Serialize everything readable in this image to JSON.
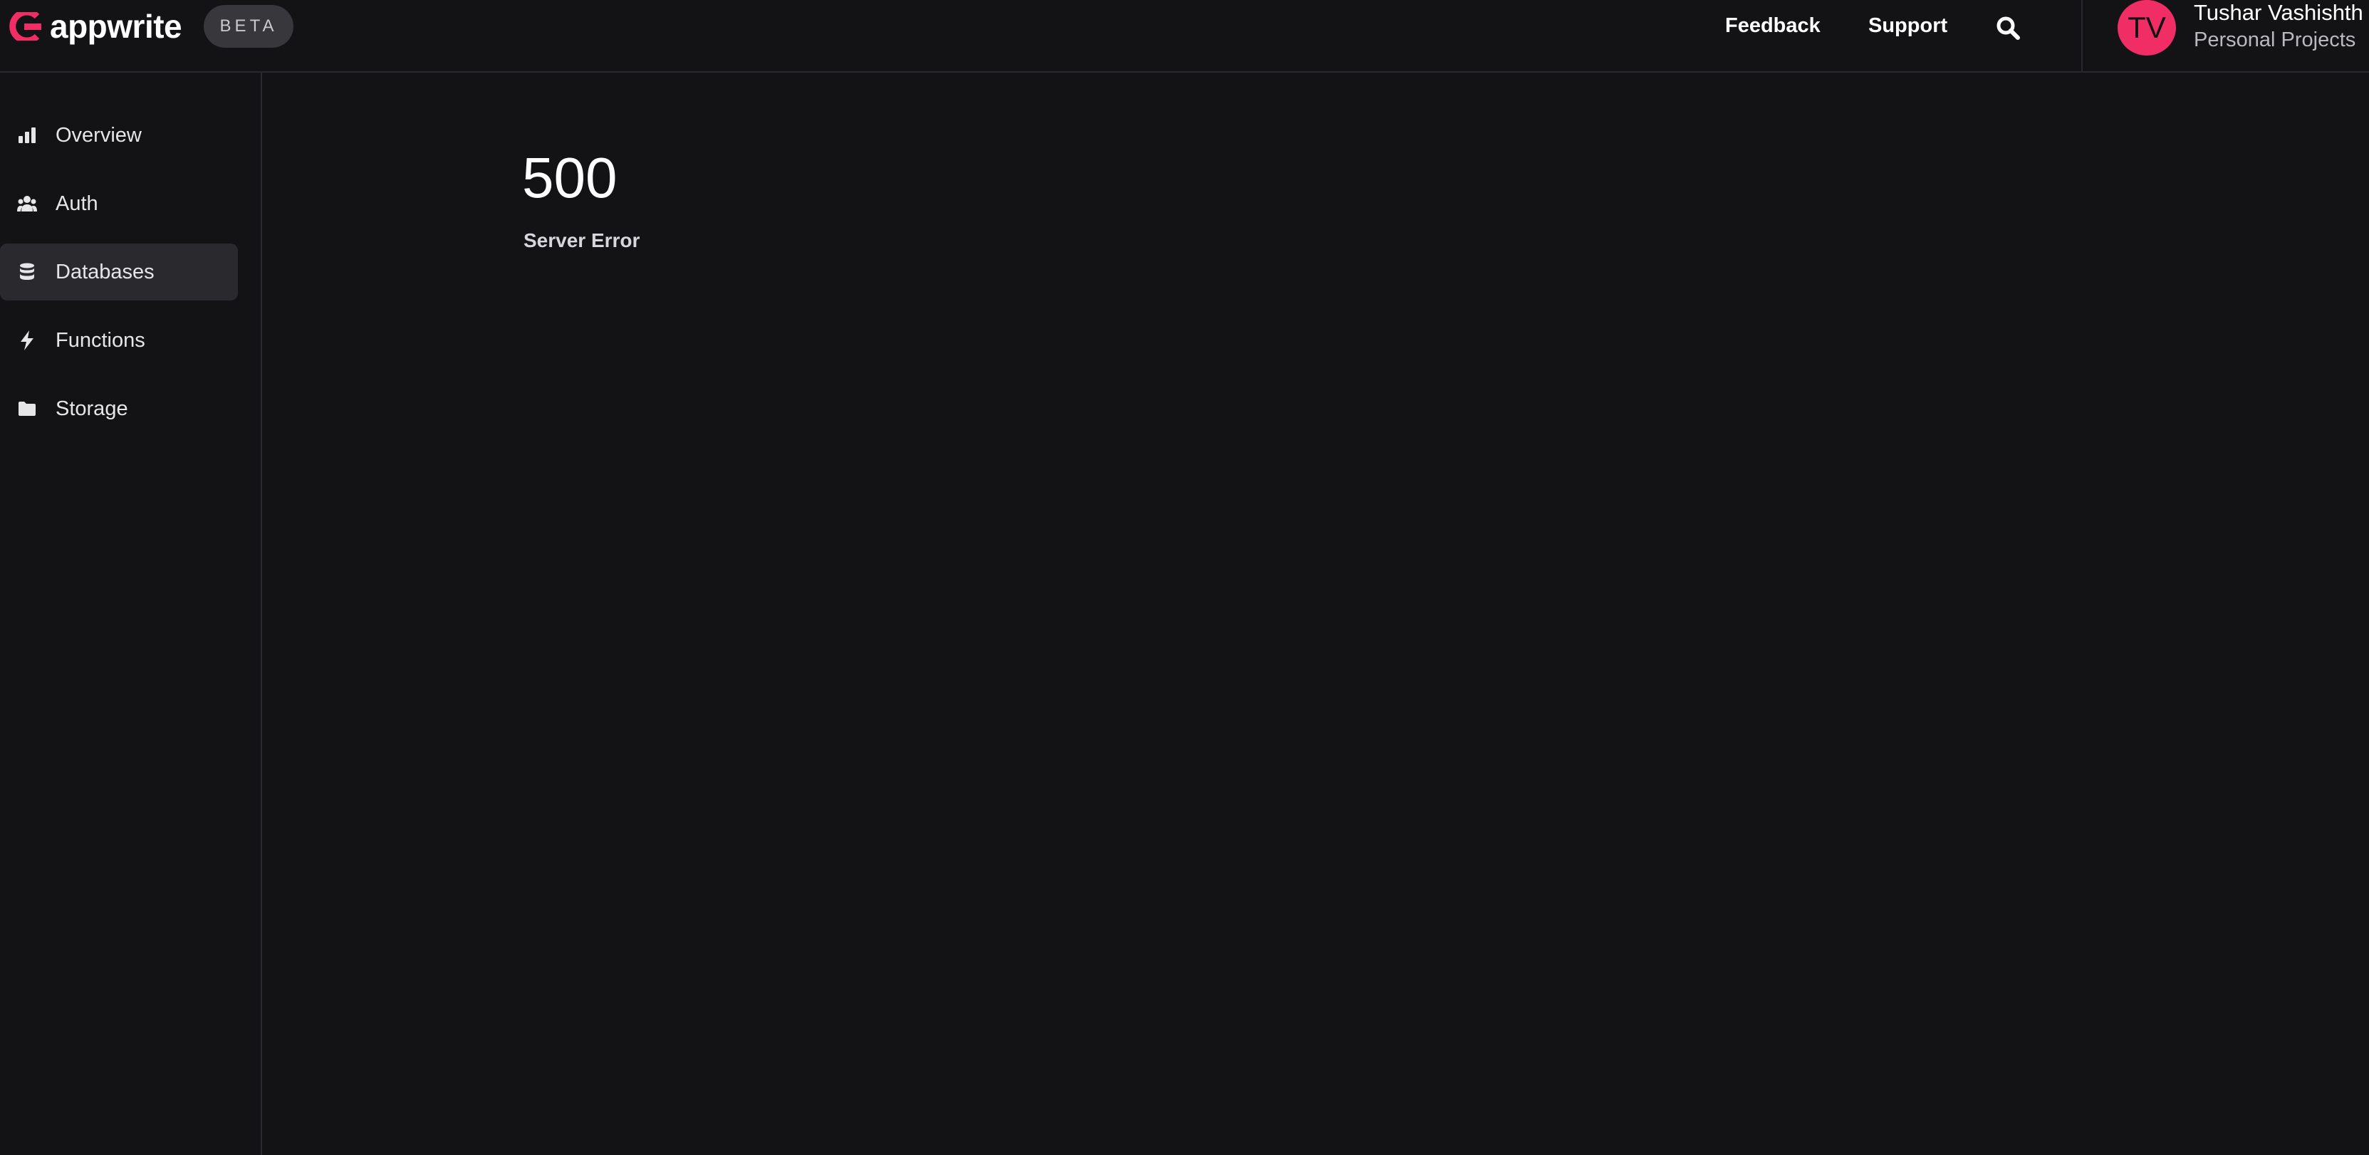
{
  "app": {
    "logo_text": "appwrite",
    "badge": "BETA",
    "brand_color": "#f02e65"
  },
  "header": {
    "feedback_label": "Feedback",
    "support_label": "Support",
    "search_icon": "search-icon"
  },
  "user": {
    "initials": "TV",
    "name": "Tushar Vashishth",
    "organization": "Personal Projects"
  },
  "sidebar": {
    "active": "Databases",
    "items": [
      {
        "label": "Overview",
        "icon": "bar-chart-icon"
      },
      {
        "label": "Auth",
        "icon": "users-icon"
      },
      {
        "label": "Databases",
        "icon": "database-icon"
      },
      {
        "label": "Functions",
        "icon": "lightning-icon"
      },
      {
        "label": "Storage",
        "icon": "folder-icon"
      }
    ]
  },
  "main": {
    "error_code": "500",
    "error_message": "Server Error"
  }
}
